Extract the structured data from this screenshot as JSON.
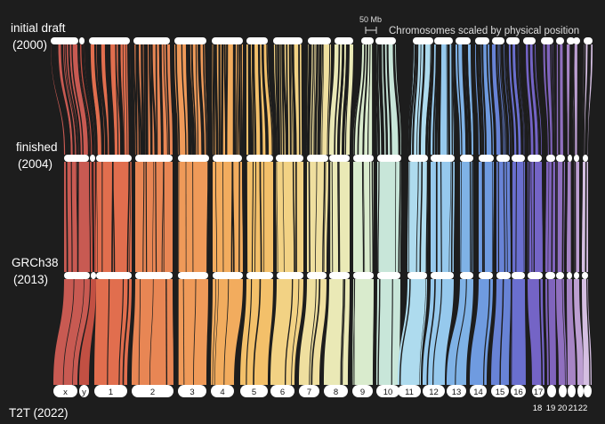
{
  "assemblies": [
    {
      "name": "initial draft",
      "year": "(2000)"
    },
    {
      "name": "finished",
      "year": "(2004)"
    },
    {
      "name": "GRCh38",
      "year": "(2013)"
    },
    {
      "name": "T2T (2022)"
    }
  ],
  "scale_bar": {
    "label": "50 Mb",
    "caption": "Chromosomes scaled by physical position"
  },
  "chromosomes": [
    {
      "label": "x",
      "color": "#c85a52"
    },
    {
      "label": "y",
      "color": "#c25043"
    },
    {
      "label": "1",
      "color": "#e16e4e"
    },
    {
      "label": "2",
      "color": "#e88654"
    },
    {
      "label": "3",
      "color": "#ef9a59"
    },
    {
      "label": "4",
      "color": "#f2ac5e"
    },
    {
      "label": "5",
      "color": "#f3c06a"
    },
    {
      "label": "6",
      "color": "#f2d284"
    },
    {
      "label": "7",
      "color": "#efdf9f"
    },
    {
      "label": "8",
      "color": "#eae9b6"
    },
    {
      "label": "9",
      "color": "#d9ebcd"
    },
    {
      "label": "10",
      "color": "#c8e6d9"
    },
    {
      "label": "11",
      "color": "#aedbee"
    },
    {
      "label": "12",
      "color": "#96c9ed"
    },
    {
      "label": "13",
      "color": "#7fb2e6"
    },
    {
      "label": "14",
      "color": "#6f9be0"
    },
    {
      "label": "15",
      "color": "#6883d6"
    },
    {
      "label": "16",
      "color": "#6a6fcf"
    },
    {
      "label": "17",
      "color": "#7464c6"
    },
    {
      "label": "18",
      "color": "#8064bd"
    },
    {
      "label": "19",
      "color": "#9070bf"
    },
    {
      "label": "20",
      "color": "#a785c5"
    },
    {
      "label": "21",
      "color": "#bd9fd2"
    },
    {
      "label": "22",
      "color": "#d5bfe2"
    }
  ]
}
